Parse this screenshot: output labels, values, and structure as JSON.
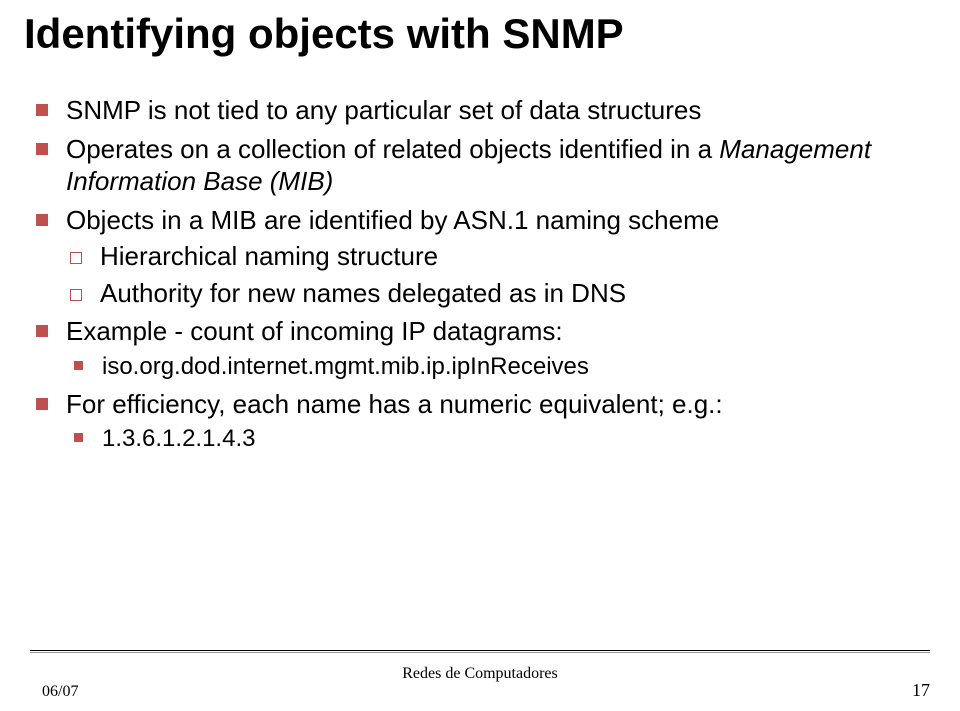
{
  "title": "Identifying objects with SNMP",
  "bullets": {
    "b1": "SNMP is not tied to any particular set of data structures",
    "b2_pre": "Operates on a collection of related objects identified in a ",
    "b2_em": "Management Information Base (MIB)",
    "b3": "Objects in a MIB are identified by ASN.1 naming scheme",
    "b3a": "Hierarchical naming structure",
    "b3b": "Authority for new names delegated as in DNS",
    "b4": "Example - count of incoming IP datagrams:",
    "b4a": "iso.org.dod.internet.mgmt.mib.ip.ipInReceives",
    "b5": "For efficiency, each name has a numeric equivalent; e.g.:",
    "b5a": "1.3.6.1.2.1.4.3"
  },
  "footer": {
    "center": "Redes de Computadores",
    "left": "06/07",
    "right": "17"
  }
}
